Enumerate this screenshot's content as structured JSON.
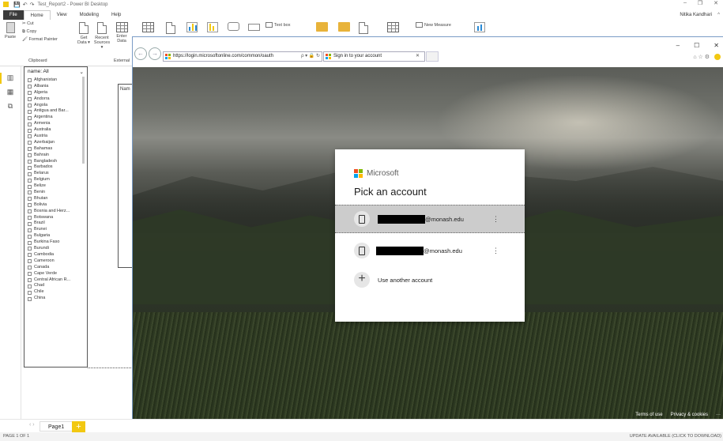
{
  "app": {
    "title": "Test_Report2 - Power BI Desktop",
    "user": "Nitika Kandhari",
    "window_controls": [
      "–",
      "❐",
      "✕"
    ]
  },
  "tabs": [
    "File",
    "Home",
    "View",
    "Modeling",
    "Help"
  ],
  "ribbon": {
    "paste": "Paste",
    "cut": "Cut",
    "copy": "Copy",
    "format_painter": "Format Painter",
    "clipboard": "Clipboard",
    "get_data": "Get Data ▾",
    "recent_sources": "Recent Sources ▾",
    "enter_data": "Enter Data",
    "external": "External",
    "text_box": "Text box",
    "new_measure": "New Measure"
  },
  "slicer": {
    "header": "name: All",
    "items": [
      "Afghanistan",
      "Albania",
      "Algeria",
      "Andorra",
      "Angola",
      "Antigua and Bar...",
      "Argentina",
      "Armenia",
      "Australia",
      "Austria",
      "Azerbaijan",
      "Bahamas",
      "Bahrain",
      "Bangladesh",
      "Barbados",
      "Belarus",
      "Belgium",
      "Belize",
      "Benin",
      "Bhutan",
      "Bolivia",
      "Bosnia and Herz...",
      "Botswana",
      "Brazil",
      "Brunei",
      "Bulgaria",
      "Burkina Faso",
      "Burundi",
      "Cambodia",
      "Cameroon",
      "Canada",
      "Cape Verde",
      "Central African R...",
      "Chad",
      "Chile",
      "China"
    ]
  },
  "visual": {
    "title_fragment": "Nam"
  },
  "browser": {
    "url": "https://login.microsoftonline.com/common/oauth",
    "url_icons": "ρ ▾ 🔒 ↻",
    "tab_title": "Sign in to your account",
    "tab_close": "✕",
    "window_controls": [
      "–",
      "☐",
      "✕"
    ],
    "fav_icons": "⌂ ☆ ⚙"
  },
  "dialog": {
    "brand": "Microsoft",
    "heading": "Pick an account",
    "accounts": [
      {
        "email": "@monash.edu",
        "selected": true
      },
      {
        "email": "@monash.edu",
        "selected": false
      }
    ],
    "more": "⋮",
    "use_another": "Use another account"
  },
  "footer": {
    "terms": "Terms of use",
    "privacy": "Privacy & cookies",
    "more": "···"
  },
  "pages": {
    "tab": "Page1",
    "add": "+"
  },
  "status": {
    "left": "PAGE 1 OF 1",
    "right": "UPDATE AVAILABLE (CLICK TO DOWNLOAD)"
  },
  "colors": {
    "pbi_yellow": "#f2c811",
    "ms_red": "#f25022",
    "ms_green": "#7fba00",
    "ms_blue": "#00a4ef",
    "ms_yellow": "#ffb900"
  }
}
